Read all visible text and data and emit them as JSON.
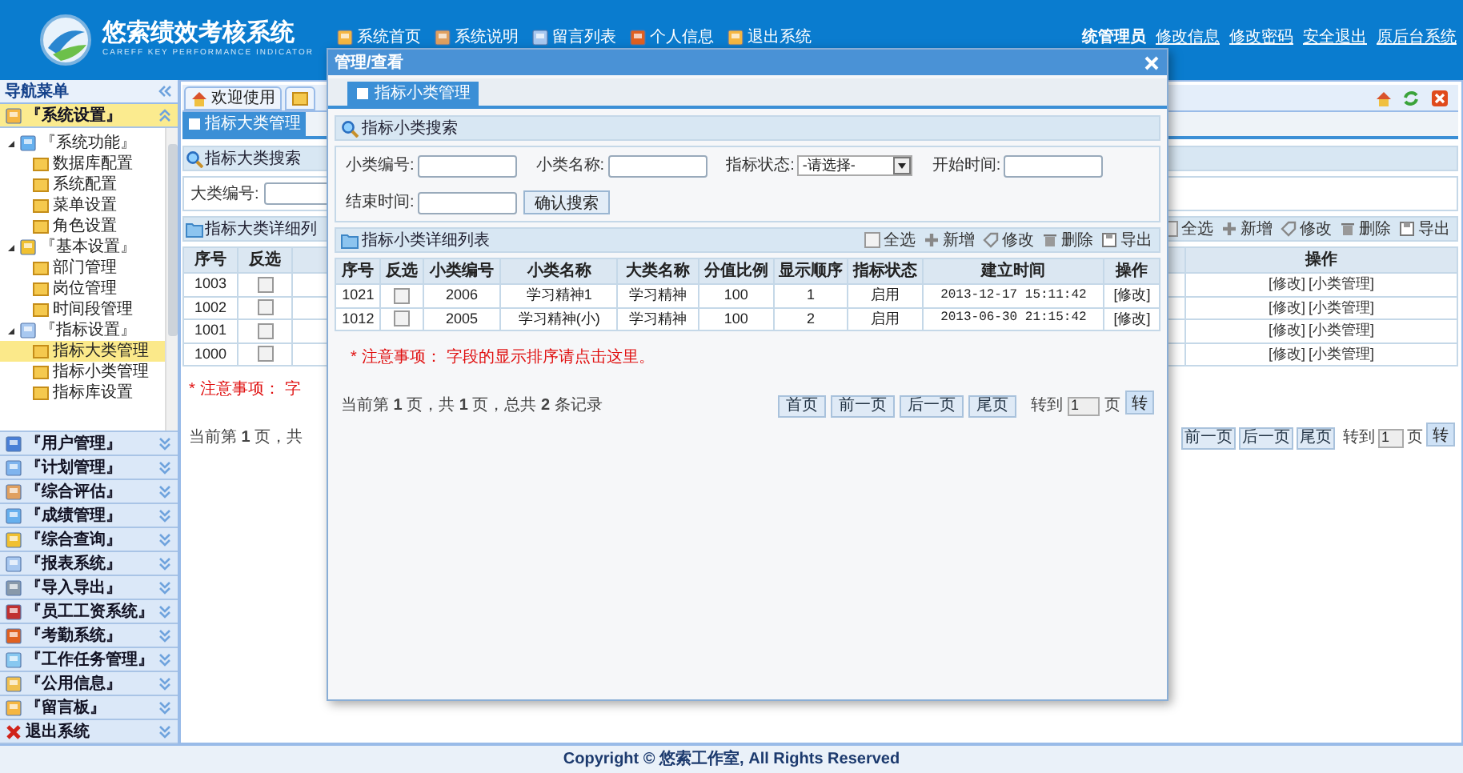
{
  "header": {
    "title": "悠索绩效考核系统",
    "subtitle": "CAREFF KEY PERFORMANCE INDICATOR",
    "nav": [
      {
        "label": "系统首页"
      },
      {
        "label": "系统说明"
      },
      {
        "label": "留言列表"
      },
      {
        "label": "个人信息"
      },
      {
        "label": "退出系统"
      }
    ],
    "user": "统管理员",
    "links": [
      "修改信息",
      "修改密码",
      "安全退出",
      "原后台系统"
    ]
  },
  "sidebar": {
    "title": "导航菜单",
    "sections": [
      {
        "label": "『系统设置』",
        "expanded": true,
        "kind": "menu",
        "tree": [
          {
            "label": "『系统功能』",
            "expanded": true,
            "children": [
              {
                "label": "数据库配置",
                "selected": false
              },
              {
                "label": "系统配置",
                "selected": false
              },
              {
                "label": "菜单设置",
                "selected": false
              },
              {
                "label": "角色设置",
                "selected": false
              }
            ]
          },
          {
            "label": "『基本设置』",
            "expanded": true,
            "children": [
              {
                "label": "部门管理",
                "selected": false
              },
              {
                "label": "岗位管理",
                "selected": false
              },
              {
                "label": "时间段管理",
                "selected": false
              }
            ]
          },
          {
            "label": "『指标设置』",
            "expanded": true,
            "children": [
              {
                "label": "指标大类管理",
                "selected": true
              },
              {
                "label": "指标小类管理",
                "selected": false
              },
              {
                "label": "指标库设置",
                "selected": false
              }
            ]
          }
        ]
      },
      {
        "label": "『用户管理』",
        "expanded": false,
        "kind": "menu"
      },
      {
        "label": "『计划管理』",
        "expanded": false,
        "kind": "menu"
      },
      {
        "label": "『综合评估』",
        "expanded": false,
        "kind": "menu"
      },
      {
        "label": "『成绩管理』",
        "expanded": false,
        "kind": "menu"
      },
      {
        "label": "『综合查询』",
        "expanded": false,
        "kind": "menu"
      },
      {
        "label": "『报表系统』",
        "expanded": false,
        "kind": "menu"
      },
      {
        "label": "『导入导出』",
        "expanded": false,
        "kind": "menu"
      },
      {
        "label": "『员工工资系统』",
        "expanded": false,
        "kind": "menu"
      },
      {
        "label": "『考勤系统』",
        "expanded": false,
        "kind": "menu"
      },
      {
        "label": "『工作任务管理』",
        "expanded": false,
        "kind": "menu"
      },
      {
        "label": "『公用信息』",
        "expanded": false,
        "kind": "menu"
      },
      {
        "label": "『留言板』",
        "expanded": false,
        "kind": "menu"
      },
      {
        "label": "退出系统",
        "expanded": false,
        "kind": "exit"
      }
    ]
  },
  "main": {
    "tabs": [
      {
        "label": "欢迎使用",
        "selected": false
      },
      {
        "selected": false
      }
    ],
    "subtab": "指标大类管理",
    "search_title": "指标大类搜索",
    "search_fields": [
      {
        "label": "大类编号:"
      }
    ],
    "list_title": "指标大类详细列",
    "toolbar": [
      {
        "label": "全选",
        "kind": "checkbox",
        "checked": false
      },
      {
        "label": "新增",
        "kind": "add"
      },
      {
        "label": "修改",
        "kind": "edit"
      },
      {
        "label": "删除",
        "kind": "delete"
      },
      {
        "label": "导出",
        "kind": "export"
      }
    ],
    "table": {
      "columns": [
        "序号",
        "反选",
        "操作"
      ],
      "rows": [
        {
          "id": "1003",
          "checked": false,
          "actions": [
            "[修改]",
            "[小类管理]"
          ]
        },
        {
          "id": "1002",
          "checked": false,
          "actions": [
            "[修改]",
            "[小类管理]"
          ]
        },
        {
          "id": "1001",
          "checked": false,
          "actions": [
            "[修改]",
            "[小类管理]"
          ]
        },
        {
          "id": "1000",
          "checked": false,
          "actions": [
            "[修改]",
            "[小类管理]"
          ]
        }
      ]
    },
    "note": {
      "mark": "*",
      "label": "注意事项：",
      "text": "字"
    },
    "pagination": {
      "summary": "当前第 **1** 页，共",
      "buttons": [
        "前一页",
        "后一页",
        "尾页"
      ],
      "goto": "转到",
      "page_value": "1",
      "page_unit": "页",
      "go": "转"
    }
  },
  "modal": {
    "title": "管理/查看",
    "tab": "指标小类管理",
    "search_title": "指标小类搜索",
    "fields": [
      {
        "label": "小类编号:",
        "kind": "text"
      },
      {
        "label": "小类名称:",
        "kind": "text"
      },
      {
        "label": "指标状态:",
        "kind": "select",
        "value": "-请选择-"
      },
      {
        "label": "开始时间:",
        "kind": "text"
      },
      {
        "label": "结束时间:",
        "kind": "text"
      }
    ],
    "search_button": "确认搜索",
    "list_title": "指标小类详细列表",
    "toolbar": [
      {
        "label": "全选",
        "kind": "checkbox",
        "checked": false
      },
      {
        "label": "新增",
        "kind": "add"
      },
      {
        "label": "修改",
        "kind": "edit"
      },
      {
        "label": "删除",
        "kind": "delete"
      },
      {
        "label": "导出",
        "kind": "export"
      }
    ],
    "table": {
      "columns": [
        "序号",
        "反选",
        "小类编号",
        "小类名称",
        "大类名称",
        "分值比例",
        "显示顺序",
        "指标状态",
        "建立时间",
        "操作"
      ],
      "rows": [
        {
          "cells": [
            "1021",
            "",
            "2006",
            "学习精神1",
            "学习精神",
            "100",
            "1",
            "启用",
            "2013-12-17 15:11:42",
            "[修改]"
          ],
          "checked": false
        },
        {
          "cells": [
            "1012",
            "",
            "2005",
            "学习精神(小)",
            "学习精神",
            "100",
            "2",
            "启用",
            "2013-06-30 21:15:42",
            "[修改]"
          ],
          "checked": false
        }
      ]
    },
    "note": {
      "mark": "*",
      "label": "注意事项：",
      "text": "字段的显示排序请点击这里。"
    },
    "pagination": {
      "summary": "当前第 **1** 页，共 **1** 页，总共 **2** 条记录",
      "buttons": [
        "首页",
        "前一页",
        "后一页",
        "尾页"
      ],
      "goto": "转到",
      "page_value": "1",
      "page_unit": "页",
      "go": "转"
    }
  },
  "footer": "Copyright © 悠索工作室, All Rights Reserved"
}
